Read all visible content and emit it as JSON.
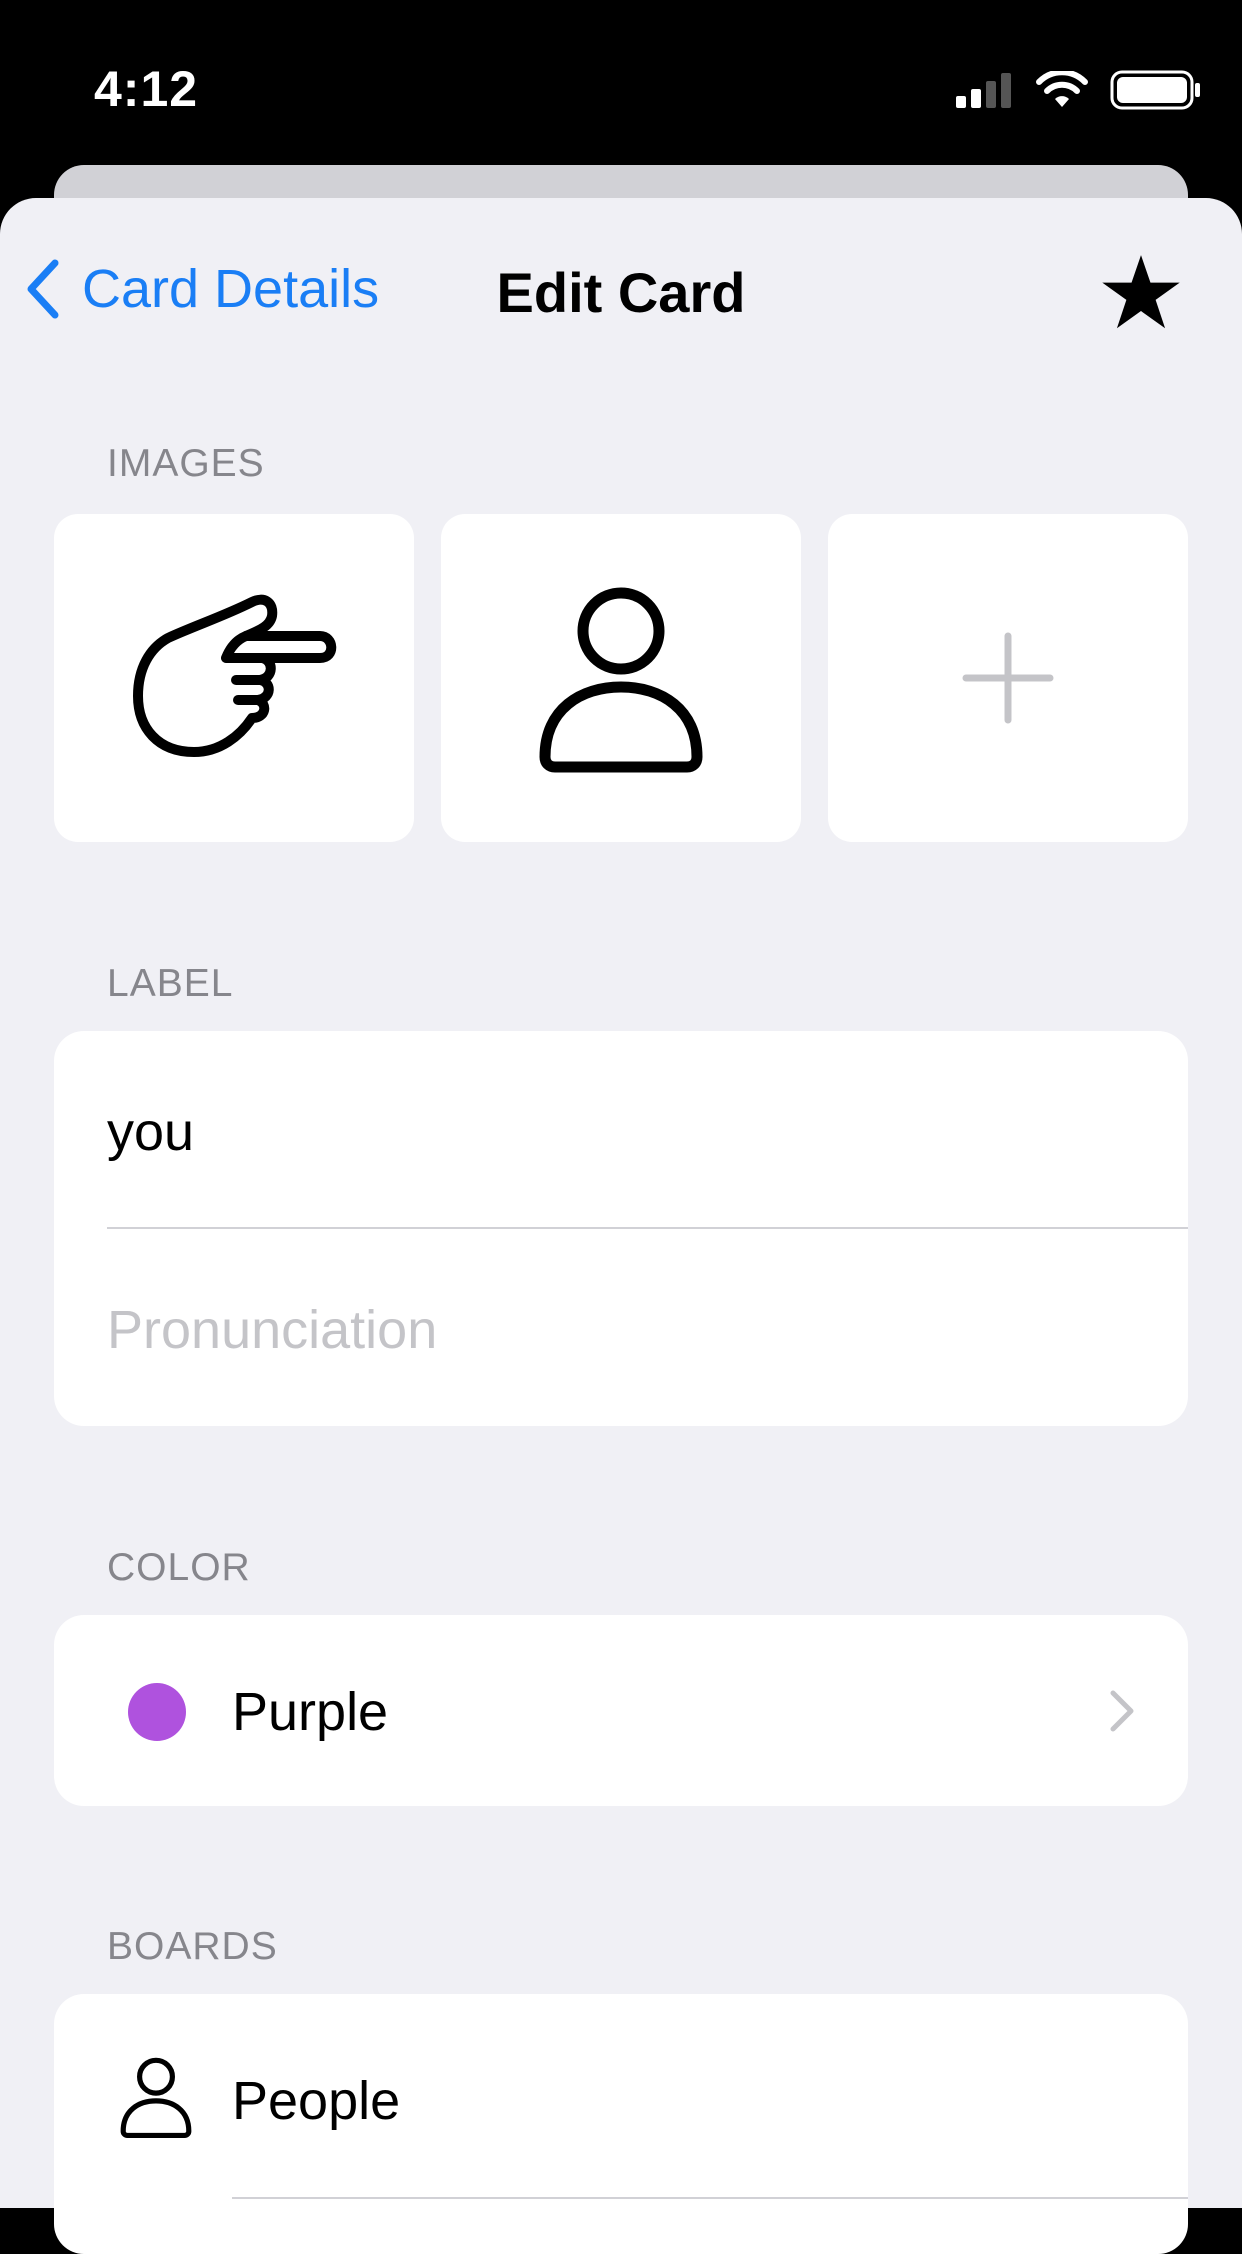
{
  "status_bar": {
    "time": "4:12"
  },
  "nav": {
    "back_label": "Card Details",
    "title": "Edit Card"
  },
  "sections": {
    "images": "IMAGES",
    "label": "LABEL",
    "color": "COLOR",
    "boards": "BOARDS"
  },
  "images": [
    {
      "icon": "pointing-hand-icon"
    },
    {
      "icon": "person-icon"
    },
    {
      "icon": "plus-icon"
    }
  ],
  "label": {
    "value": "you",
    "pronunciation_placeholder": "Pronunciation"
  },
  "color": {
    "name": "Purple",
    "swatch": "#af52de"
  },
  "boards": [
    {
      "name": "People",
      "icon": "person-icon"
    }
  ],
  "colors": {
    "accent": "#1a7ef5",
    "background": "#f0f0f5",
    "secondary_text": "#86868c",
    "placeholder": "#c4c4c8"
  }
}
